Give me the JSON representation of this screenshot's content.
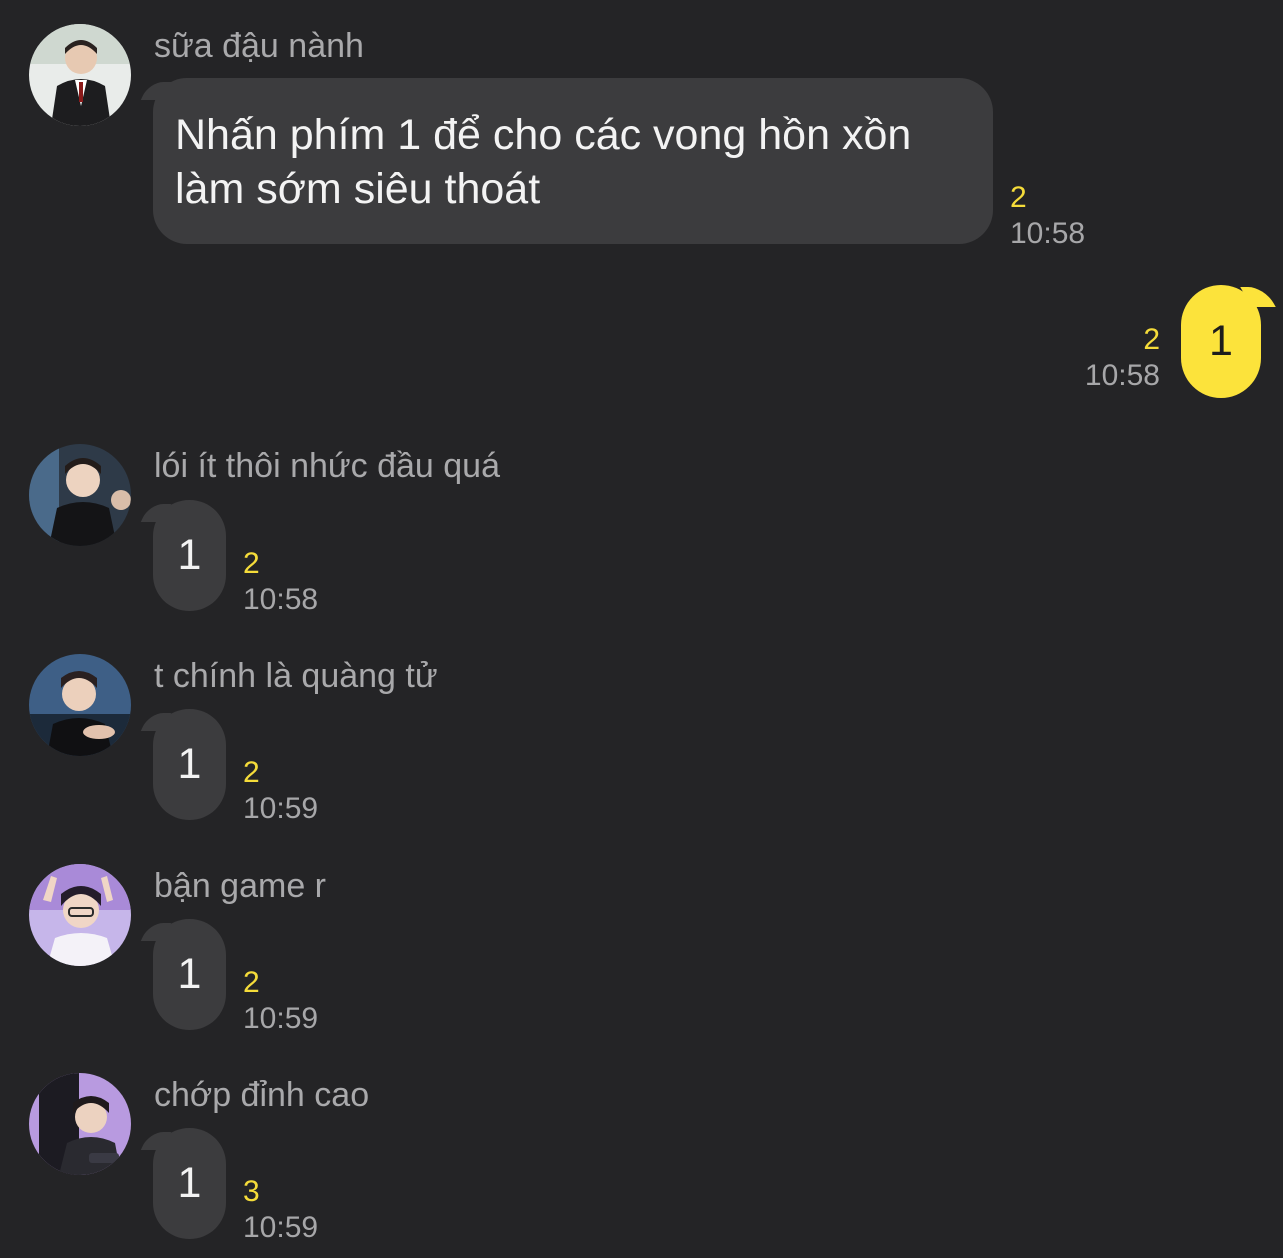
{
  "messages": [
    {
      "sender": "sữa đậu nành",
      "text_line1": "Nhấn phím 1 để cho các vong hồn xồn",
      "text_line2": "làm sớm siêu thoát",
      "unread": "2",
      "time": "10:58"
    },
    {
      "sender": "",
      "text": "1",
      "unread": "2",
      "time": "10:58",
      "mine": true
    },
    {
      "sender": "lói ít thôi nhức đầu quá",
      "text": "1",
      "unread": "2",
      "time": "10:58"
    },
    {
      "sender": "t chính là quàng tử",
      "text": "1",
      "unread": "2",
      "time": "10:59"
    },
    {
      "sender": "bận game r",
      "text": "1",
      "unread": "2",
      "time": "10:59"
    },
    {
      "sender": "chớp đỉnh cao",
      "text": "1",
      "unread": "3",
      "time": "10:59"
    }
  ],
  "colors": {
    "background": "#242426",
    "incoming_bubble": "#3c3c3e",
    "outgoing_bubble": "#fce33b",
    "unread_count": "#f5dc3a",
    "timestamp": "#a7a7a9"
  }
}
